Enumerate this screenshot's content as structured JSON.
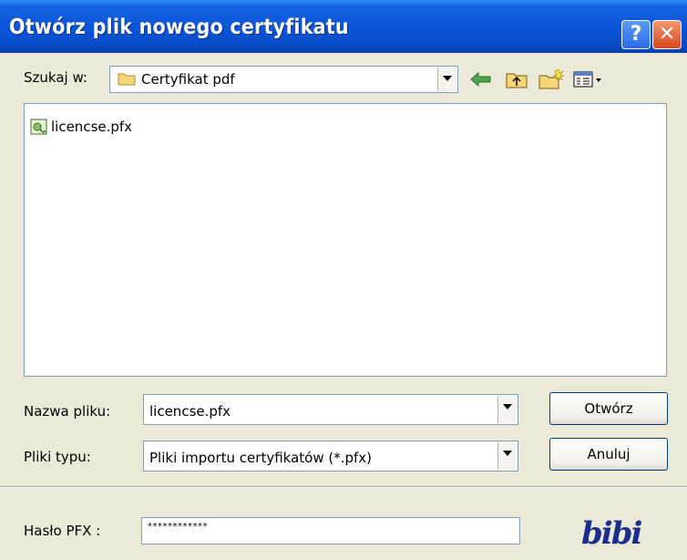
{
  "window": {
    "title": "Otwórz plik nowego certyfikatu",
    "help_glyph": "?",
    "close_glyph": "✕"
  },
  "lookin": {
    "label": "Szukaj w:",
    "value": "Certyfikat pdf"
  },
  "toolbar": {
    "icons": [
      "back-icon",
      "up-folder-icon",
      "new-folder-icon",
      "view-menu-icon"
    ]
  },
  "files": [
    {
      "name": "licencse.pfx",
      "icon": "certificate-file-icon"
    }
  ],
  "filename": {
    "label": "Nazwa pliku:",
    "value": "licencse.pfx"
  },
  "filetype": {
    "label": "Pliki typu:",
    "value": "Pliki importu certyfikatów (*.pfx)"
  },
  "buttons": {
    "open": "Otwórz",
    "cancel": "Anuluj"
  },
  "password": {
    "label": "Hasło PFX :",
    "value": "************"
  },
  "logo_text": "bibi",
  "colors": {
    "titlebar": "#0a54d8",
    "face": "#ece9d8",
    "border": "#7f9db9"
  }
}
